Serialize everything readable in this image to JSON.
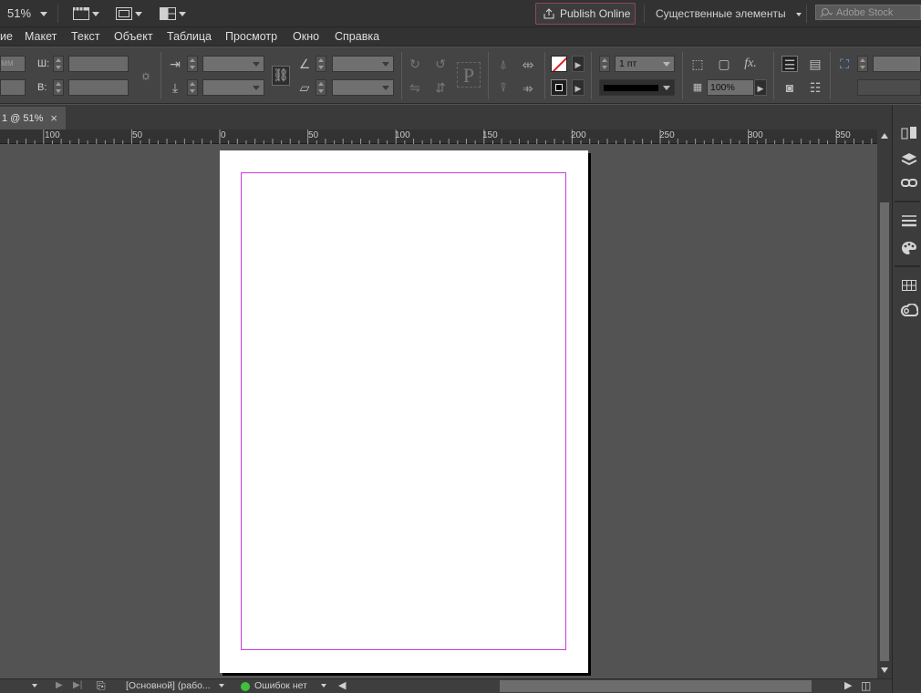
{
  "appbar": {
    "zoom": "51%",
    "publish_label": "Publish Online",
    "workspace": "Существенные элементы",
    "search_placeholder": "Adobe Stock"
  },
  "menu": [
    "ие",
    "Макет",
    "Текст",
    "Объект",
    "Таблица",
    "Просмотр",
    "Окно",
    "Справка"
  ],
  "control": {
    "field_left_partial": "мм",
    "w_label": "Ш:",
    "h_label": "В:",
    "stroke_weight": "1 пт",
    "opacity": "100%"
  },
  "tab": {
    "title": "1 @ 51%",
    "close": "×"
  },
  "ruler": {
    "labels": [
      "100",
      "50",
      "0",
      "50",
      "100",
      "150",
      "200",
      "250",
      "300",
      "350"
    ]
  },
  "status": {
    "master": "[Основной] (рабо...",
    "errors": "Ошибок нет"
  },
  "colors": {
    "margin_guide": "#c83cd8",
    "publish_border": "#8e4562",
    "status_ok": "#3ec23e"
  }
}
